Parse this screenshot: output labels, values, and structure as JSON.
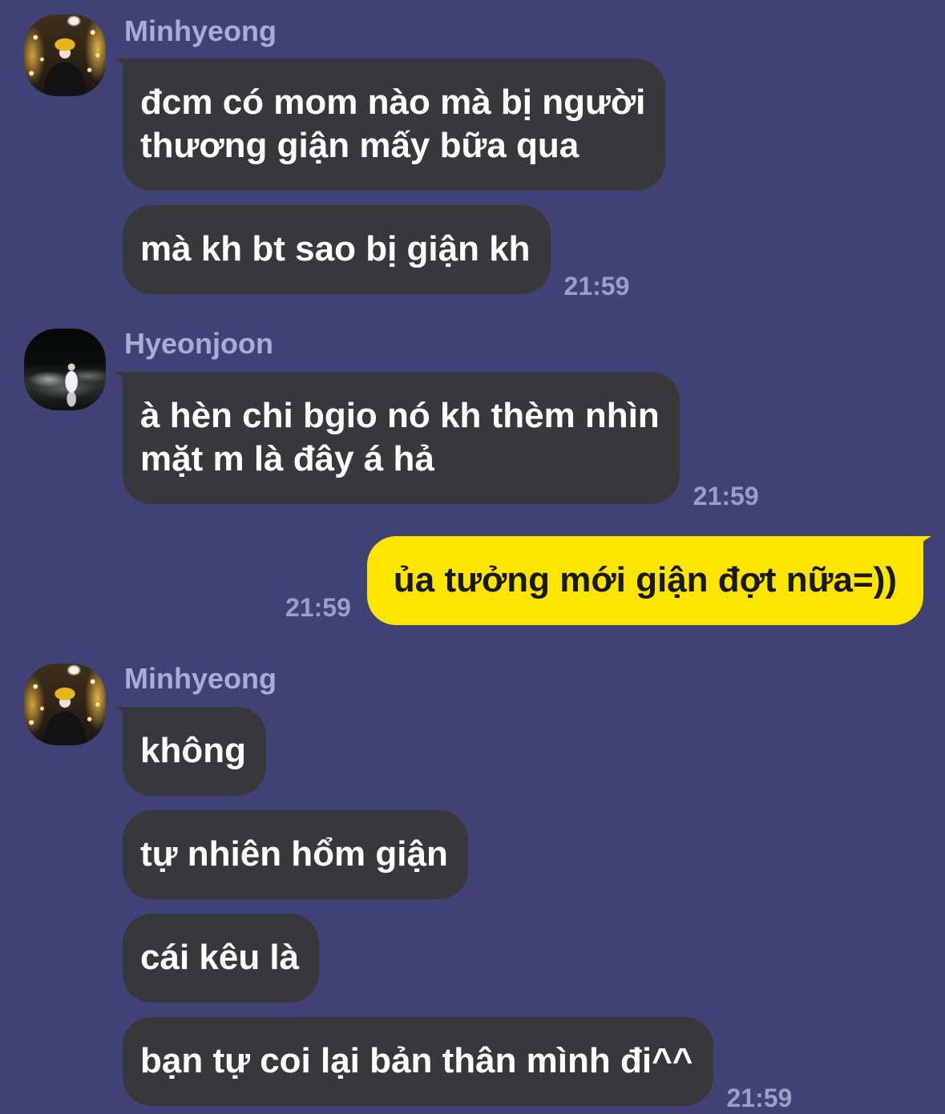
{
  "theme": {
    "background": "#404275",
    "incoming_bubble": "#38383a",
    "incoming_text": "#ffffff",
    "outgoing_bubble": "#fee500",
    "outgoing_text": "#191919",
    "sender_name": "#a9acd4",
    "timestamp": "#9b9ec8"
  },
  "chat": [
    {
      "sender": "Minhyeong",
      "messages": [
        {
          "lines": [
            "đcm có mom nào mà bị người",
            "thương giận mấy bữa qua"
          ]
        },
        {
          "lines": [
            "mà kh bt sao bị giận kh"
          ]
        }
      ],
      "time": "21:59"
    },
    {
      "sender": "Hyeonjoon",
      "messages": [
        {
          "lines": [
            "à hèn chi bgio nó kh thèm nhìn",
            "mặt m là đây á hả"
          ]
        }
      ],
      "time": "21:59"
    },
    {
      "outgoing": true,
      "messages": [
        {
          "lines": [
            "ủa tưởng mới giận đợt nữa=))"
          ]
        }
      ],
      "time": "21:59"
    },
    {
      "sender": "Minhyeong",
      "messages": [
        {
          "lines": [
            "không"
          ]
        },
        {
          "lines": [
            "tự nhiên hổm giận"
          ]
        },
        {
          "lines": [
            "cái kêu là"
          ]
        },
        {
          "lines": [
            "bạn tự coi lại bản thân mình đi^^"
          ]
        }
      ],
      "time": "21:59"
    }
  ]
}
